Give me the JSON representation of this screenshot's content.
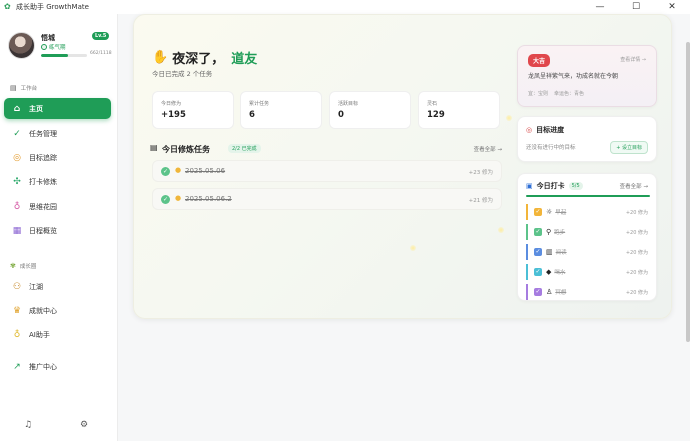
{
  "window": {
    "title": "成长助手 GrowthMate",
    "controls": [
      "—",
      "☐",
      "✕"
    ]
  },
  "profile": {
    "name": "悟城",
    "level": "Lv.5",
    "realm": "练气期",
    "exp_text": "662/1118",
    "exp_fraction": 0.59
  },
  "sidebar": {
    "section_work": "工作台",
    "section_growth": "成长圈",
    "items_work": [
      {
        "label": "主页",
        "icon": "home-icon"
      },
      {
        "label": "任务管理",
        "icon": "check-circle-icon"
      },
      {
        "label": "目标追踪",
        "icon": "target-icon"
      },
      {
        "label": "打卡修炼",
        "icon": "sparkle-icon"
      },
      {
        "label": "思维花园",
        "icon": "bulb-icon"
      },
      {
        "label": "日程概览",
        "icon": "calendar-icon"
      }
    ],
    "items_growth": [
      {
        "label": "江湖",
        "icon": "people-icon"
      },
      {
        "label": "成就中心",
        "icon": "trophy-icon"
      },
      {
        "label": "AI助手",
        "icon": "bulb-icon"
      }
    ],
    "promo": "推广中心"
  },
  "main": {
    "greeting": "夜深了，",
    "greeting_name": "道友",
    "subtitle": "今日已完成 2 个任务",
    "stats": [
      {
        "label": "今日修为",
        "value": "+195"
      },
      {
        "label": "累计任务",
        "value": "6"
      },
      {
        "label": "活跃目标",
        "value": "0"
      },
      {
        "label": "灵石",
        "value": "129"
      }
    ],
    "tasks_title": "今日修炼任务",
    "tasks_badge": "2/2 已完成",
    "tasks_more": "查看全部 →",
    "tasks": [
      {
        "text": "2025.05.06",
        "points": "+23 修为"
      },
      {
        "text": "2025.05.06.2",
        "points": "+21 修为"
      }
    ]
  },
  "fortune": {
    "tag": "大吉",
    "link": "查看详情 →",
    "text": "龙凤呈祥紫气来，功成名就在今朝",
    "meta_direction": "宜：宝则",
    "meta_color": "幸运色：青色"
  },
  "goals": {
    "title": "目标进度",
    "empty": "还没有进行中的目标",
    "button": "+ 设立目标"
  },
  "checkin": {
    "title": "今日打卡",
    "count": "5/5",
    "more": "查看全部 →",
    "progress_fraction": 1.0,
    "items": [
      {
        "label": "早起",
        "points": "+20 修为",
        "color": "#f2b53a"
      },
      {
        "label": "跑步",
        "points": "+20 修为",
        "color": "#5cc38a"
      },
      {
        "label": "阅读",
        "points": "+20 修为",
        "color": "#5b8de0"
      },
      {
        "label": "喝水",
        "points": "+20 修为",
        "color": "#4bbfd6"
      },
      {
        "label": "冥想",
        "points": "+20 修为",
        "color": "#a67ce0"
      }
    ]
  },
  "colors": {
    "accent": "#1f9d57",
    "tag_red": "#e0474c"
  }
}
